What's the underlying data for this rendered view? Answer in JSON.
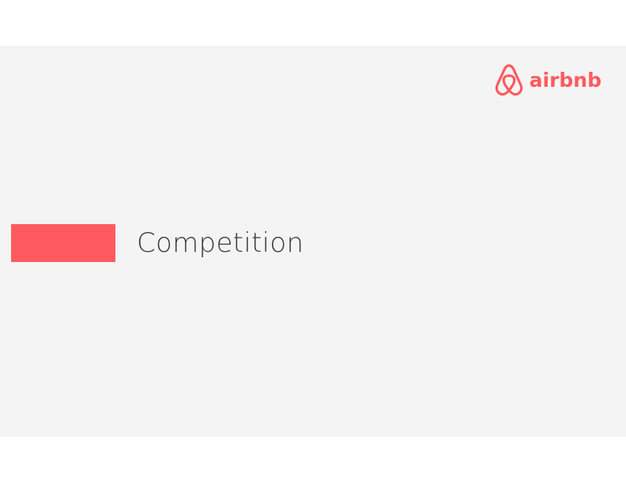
{
  "colors": {
    "brand": "#ff5a5f",
    "slide_background": "#f4f4f4",
    "title_text": "#3b3b3b"
  },
  "logo": {
    "icon": "airbnb-belo-icon",
    "wordmark": "airbnb"
  },
  "section": {
    "title": "Competition"
  }
}
